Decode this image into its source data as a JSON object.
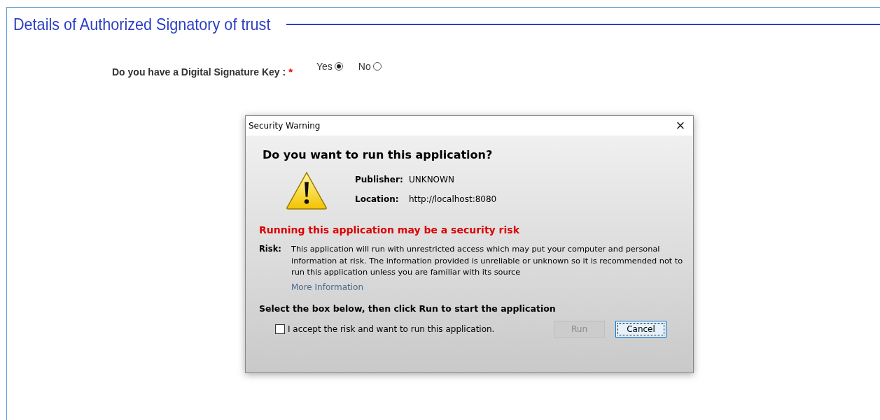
{
  "section": {
    "title": "Details of Authorized Signatory of trust"
  },
  "question": {
    "label": "Do you have a Digital Signature Key :",
    "required_mark": "*",
    "options": [
      {
        "label": "Yes",
        "selected": true
      },
      {
        "label": "No",
        "selected": false
      }
    ]
  },
  "dialog": {
    "title": "Security Warning",
    "close": "×",
    "heading": "Do you want to run this application?",
    "details": [
      {
        "label": "Publisher:",
        "value": "UNKNOWN"
      },
      {
        "label": "Location:",
        "value": "http://localhost:8080"
      }
    ],
    "warning": "Running this application may be a security risk",
    "risk_label": "Risk:",
    "risk_text": "This application will run with unrestricted access which may put your computer and personal information at risk. The information provided is unreliable or unknown so it is recommended not to run this application unless you are familiar with its source",
    "more_link": "More Information",
    "instruction": "Select the box below, then click Run to start the application",
    "accept": {
      "label": "I accept the risk and want to run this application.",
      "checked": false
    },
    "buttons": [
      {
        "label": "Run",
        "disabled": true
      },
      {
        "label": "Cancel",
        "disabled": false
      }
    ]
  }
}
